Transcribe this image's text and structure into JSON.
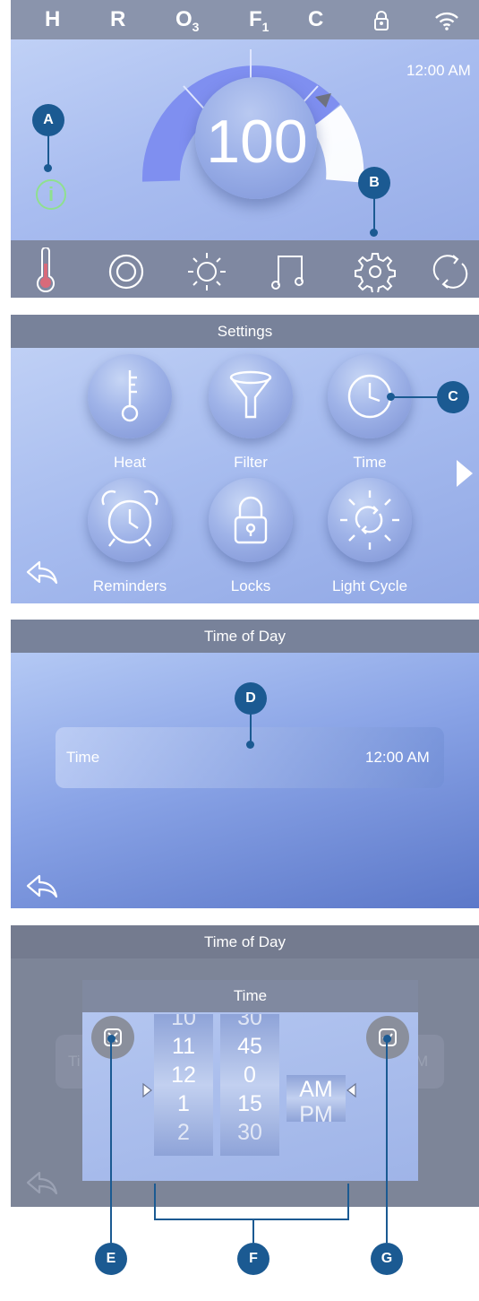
{
  "screen1": {
    "status_letters": [
      "H",
      "R",
      "O",
      "3",
      "F",
      "1",
      "C"
    ],
    "clock": "12:00 AM",
    "temperature": "100",
    "nav_icons": [
      "thermometer-icon",
      "jets-icon",
      "light-icon",
      "music-icon",
      "gear-icon",
      "refresh-icon"
    ],
    "callout_a": "A",
    "callout_b": "B"
  },
  "screen2": {
    "title": "Settings",
    "items": [
      {
        "label": "Heat",
        "icon": "heat-key-icon"
      },
      {
        "label": "Filter",
        "icon": "filter-funnel-icon"
      },
      {
        "label": "Time",
        "icon": "clock-icon"
      },
      {
        "label": "Reminders",
        "icon": "alarm-clock-icon"
      },
      {
        "label": "Locks",
        "icon": "lock-icon"
      },
      {
        "label": "Light Cycle",
        "icon": "light-cycle-icon"
      }
    ],
    "callout_c": "C"
  },
  "screen3": {
    "title": "Time of Day",
    "row_label": "Time",
    "row_value": "12:00 AM",
    "callout_d": "D"
  },
  "screen4": {
    "title": "Time of Day",
    "dialog_title": "Time",
    "bg_row_label": "Ti",
    "bg_row_value": "M",
    "hours": [
      "10",
      "11",
      "12",
      "1",
      "2"
    ],
    "minutes": [
      "30",
      "45",
      "0",
      "15",
      "30"
    ],
    "ampm": [
      "AM",
      "PM"
    ],
    "callout_e": "E",
    "callout_f": "F",
    "callout_g": "G"
  },
  "colors": {
    "callout": "#1b5a92",
    "titlebar": "#78829a",
    "gauge_blue": "#7f8ff0",
    "info_green": "#8fe08f"
  }
}
